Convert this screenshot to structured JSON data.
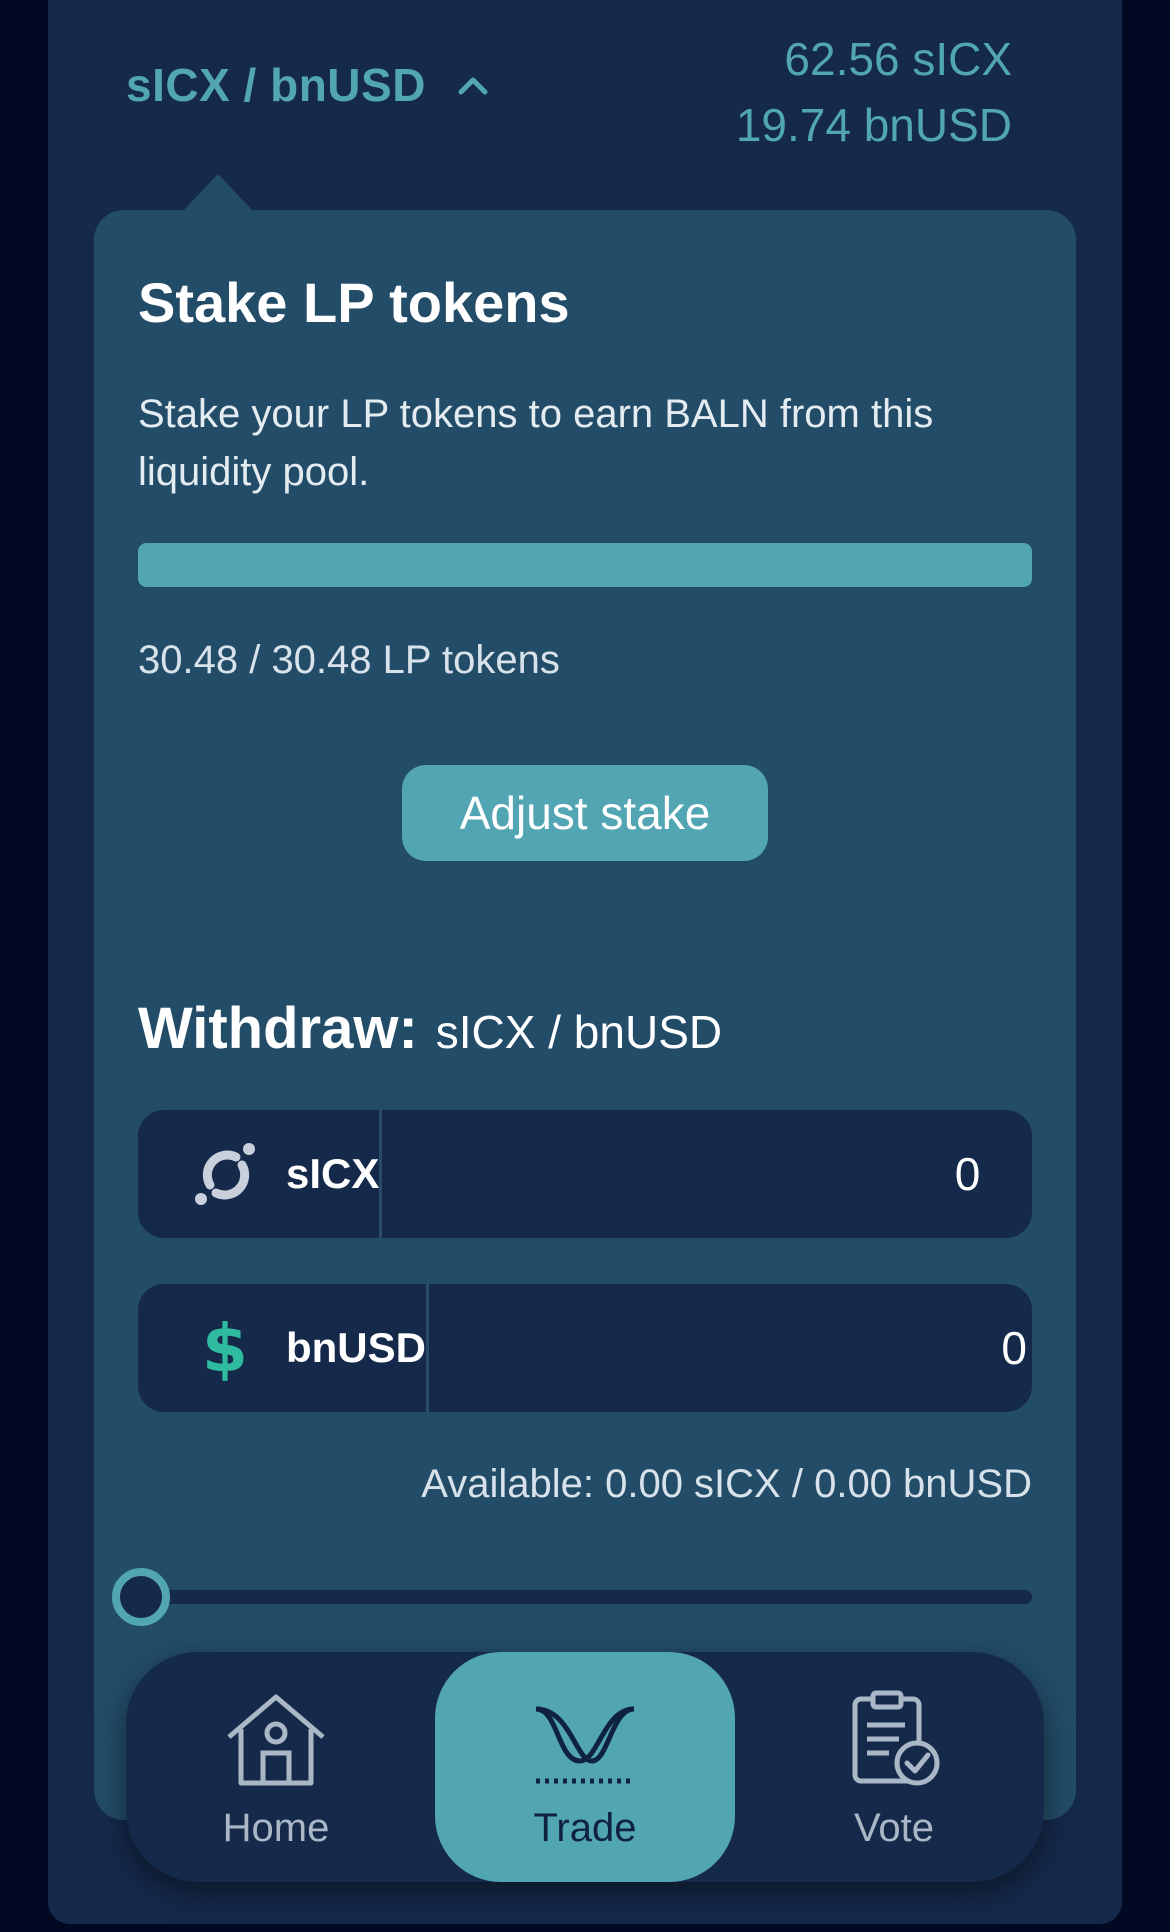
{
  "header": {
    "pair": "sICX / bnUSD",
    "balance_1": "62.56 sICX",
    "balance_2": "19.74 bnUSD"
  },
  "stake": {
    "title": "Stake LP tokens",
    "description": "Stake your LP tokens to earn BALN from this liquidity pool.",
    "progress_fraction": 1.0,
    "amount_text": "30.48 / 30.48 LP tokens",
    "adjust_button": "Adjust stake"
  },
  "withdraw": {
    "label": "Withdraw:",
    "pair": "sICX / bnUSD",
    "tokens": [
      {
        "name": "sICX",
        "value": "0",
        "icon": "icx-icon"
      },
      {
        "name": "bnUSD",
        "value": "0",
        "icon": "dollar-icon"
      }
    ],
    "available": "Available: 0.00 sICX / 0.00 bnUSD",
    "slider_fraction": 0.0
  },
  "nav": {
    "items": [
      {
        "label": "Home",
        "icon": "home-icon"
      },
      {
        "label": "Trade",
        "icon": "trade-icon",
        "active": true
      },
      {
        "label": "Vote",
        "icon": "vote-icon"
      }
    ]
  },
  "colors": {
    "accent": "#52a5b3",
    "panel": "#15294a",
    "card": "#234c68",
    "background": "#010a22",
    "dollar": "#2fbba0"
  }
}
